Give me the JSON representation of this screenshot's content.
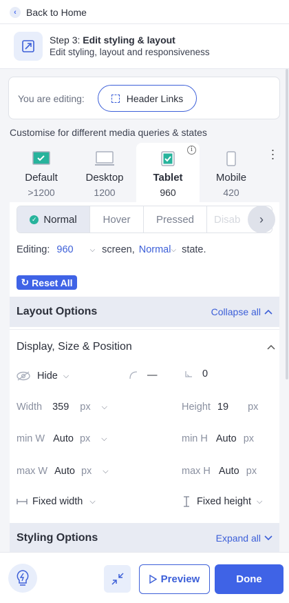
{
  "nav": {
    "back_label": "Back to Home"
  },
  "step": {
    "prefix": "Step 3: ",
    "title": "Edit styling & layout",
    "subtitle": "Edit styling, layout and responsiveness"
  },
  "editing_card": {
    "label": "You are editing:",
    "element": "Header Links"
  },
  "customise_label": "Customise for different media queries & states",
  "devices": [
    {
      "name": "Default",
      "width": ">1200",
      "icon": "default-screen-icon"
    },
    {
      "name": "Desktop",
      "width": "1200",
      "icon": "desktop-icon"
    },
    {
      "name": "Tablet",
      "width": "960",
      "icon": "tablet-icon",
      "active": true
    },
    {
      "name": "Mobile",
      "width": "420",
      "icon": "mobile-icon"
    }
  ],
  "states": [
    {
      "label": "Normal",
      "active": true
    },
    {
      "label": "Hover"
    },
    {
      "label": "Pressed"
    },
    {
      "label": "Disab"
    }
  ],
  "editing_line": {
    "prefix": "Editing:",
    "screen_value": "960",
    "screen_suffix": "screen,",
    "state_value": "Normal",
    "state_suffix": "state."
  },
  "reset_all": "Reset All",
  "layout_options": {
    "title": "Layout Options",
    "action": "Collapse all"
  },
  "display_section": {
    "title": "Display, Size & Position",
    "hide_label": "Hide",
    "radius_value": "—",
    "offset_value": "0",
    "width": {
      "label": "Width",
      "value": "359",
      "unit": "px"
    },
    "height": {
      "label": "Height",
      "value": "19",
      "unit": "px"
    },
    "min_w": {
      "label": "min W",
      "value": "Auto",
      "unit": "px"
    },
    "min_h": {
      "label": "min H",
      "value": "Auto",
      "unit": "px"
    },
    "max_w": {
      "label": "max W",
      "value": "Auto",
      "unit": "px"
    },
    "max_h": {
      "label": "max H",
      "value": "Auto",
      "unit": "px"
    },
    "fixed_width": "Fixed width",
    "fixed_height": "Fixed height"
  },
  "styling_options": {
    "title": "Styling Options",
    "action": "Expand all"
  },
  "footer": {
    "preview": "Preview",
    "done": "Done"
  },
  "colors": {
    "accent": "#3f63e6",
    "check_green": "#27b39c",
    "panel_bg": "#f4f5f8"
  }
}
